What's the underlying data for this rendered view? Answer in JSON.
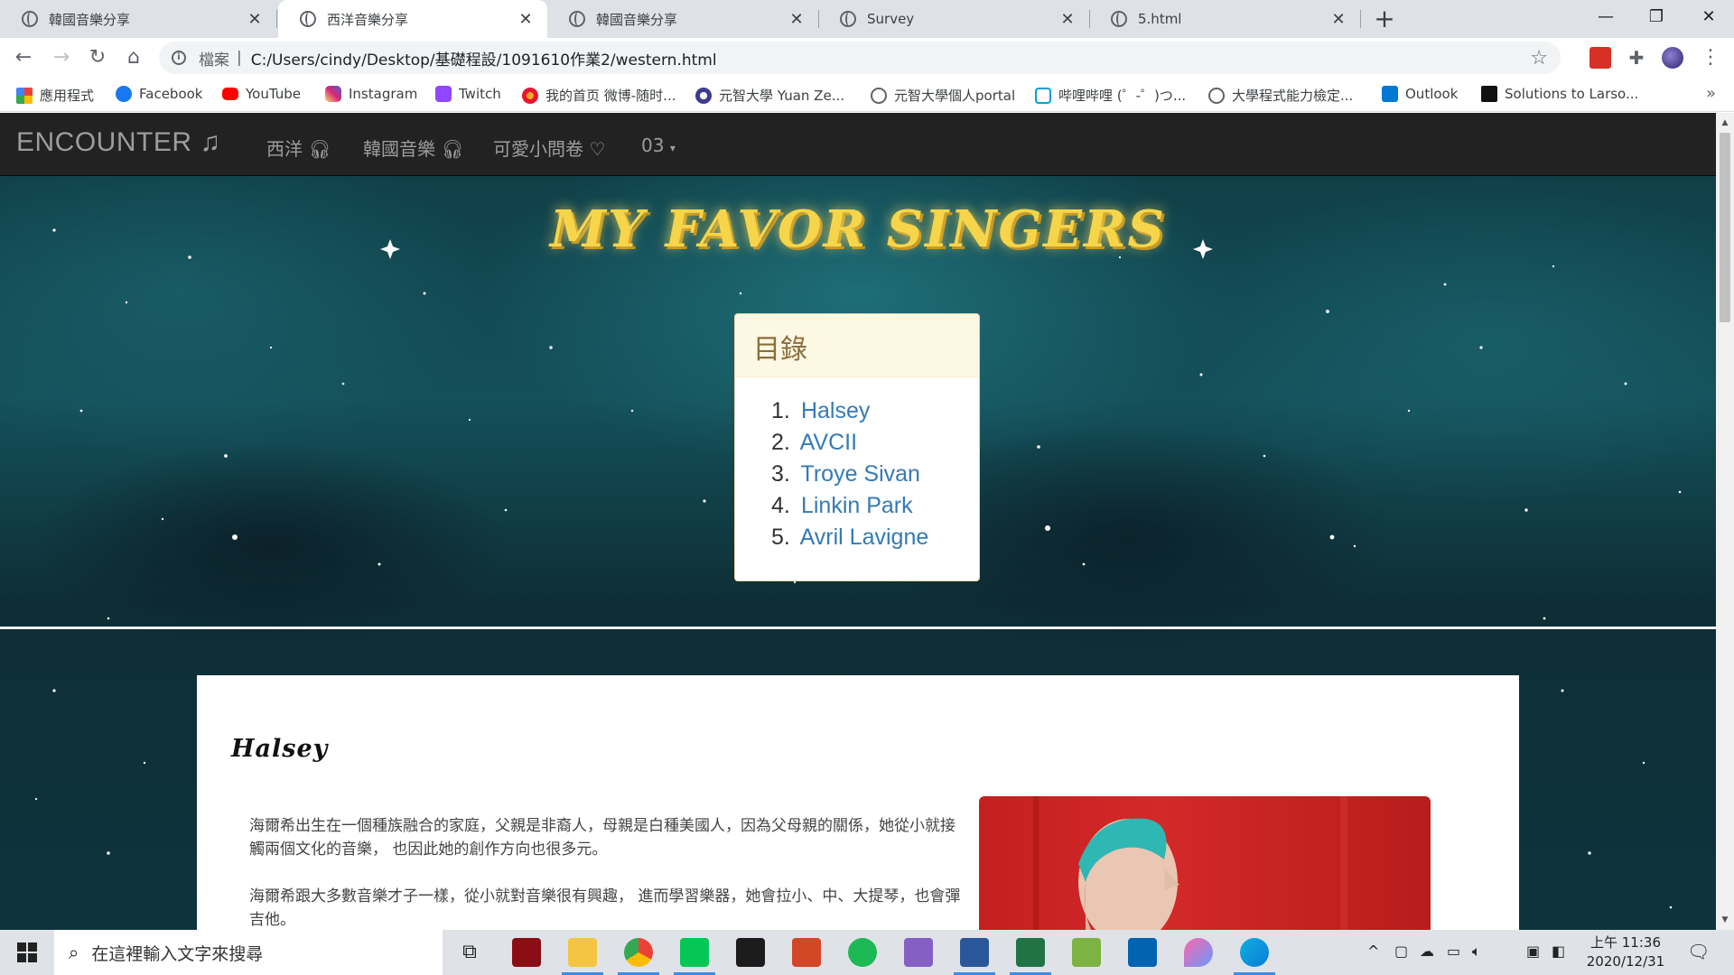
{
  "browser": {
    "tabs": [
      {
        "title": "韓國音樂分享",
        "active": false
      },
      {
        "title": "西洋音樂分享",
        "active": true
      },
      {
        "title": "韓國音樂分享",
        "active": false
      },
      {
        "title": "Survey",
        "active": false
      },
      {
        "title": "5.html",
        "active": false
      }
    ],
    "address": {
      "label": "檔案",
      "url": "C:/Users/cindy/Desktop/基礎程設/1091610作業2/western.html"
    },
    "bookmarks": [
      {
        "label": "應用程式",
        "icon": "apps-grid-icon"
      },
      {
        "label": "Facebook",
        "icon": "facebook-icon"
      },
      {
        "label": "YouTube",
        "icon": "youtube-icon"
      },
      {
        "label": "Instagram",
        "icon": "instagram-icon"
      },
      {
        "label": "Twitch",
        "icon": "twitch-icon"
      },
      {
        "label": "我的首页 微博-随时...",
        "icon": "weibo-icon"
      },
      {
        "label": "元智大學 Yuan Ze...",
        "icon": "university-seal-icon"
      },
      {
        "label": "元智大學個人portal",
        "icon": "globe-icon"
      },
      {
        "label": "哔哩哔哩 (゜-゜)つ...",
        "icon": "bilibili-icon"
      },
      {
        "label": "大學程式能力檢定...",
        "icon": "globe-icon"
      },
      {
        "label": "Outlook",
        "icon": "outlook-icon"
      },
      {
        "label": "Solutions to Larso...",
        "icon": "solutions-icon"
      }
    ],
    "bookmarks_more": "»",
    "window_controls": {
      "minimize": "—",
      "restore": "❐",
      "close": "✕"
    }
  },
  "site": {
    "brand": "ENCOUNTER",
    "brand_icon": "music-note-icon",
    "nav": [
      {
        "label": "西洋",
        "icon": "headphones-icon"
      },
      {
        "label": "韓國音樂",
        "icon": "headphones-icon"
      },
      {
        "label": "可愛小問卷",
        "icon": "heart-icon"
      },
      {
        "label": "03",
        "icon": "caret-down-icon"
      }
    ],
    "hero_title": "MY FAVOR SINGERS",
    "toc": {
      "heading": "目錄",
      "items": [
        {
          "num": "1.",
          "label": "Halsey"
        },
        {
          "num": "2.",
          "label": "AVCII"
        },
        {
          "num": "3.",
          "label": "Troye Sivan"
        },
        {
          "num": "4.",
          "label": "Linkin Park"
        },
        {
          "num": "5.",
          "label": "Avril Lavigne"
        }
      ]
    },
    "article": {
      "title": "Halsey",
      "paragraphs": [
        "海爾希出生在一個種族融合的家庭，父親是非裔人，母親是白種美國人，因為父母親的關係，她從小就接觸兩個文化的音樂， 也因此她的創作方向也很多元。",
        "海爾希跟大多數音樂才子一樣，從小就對音樂很有興趣， 進而學習樂器，她會拉小、中、大提琴，也會彈吉他。"
      ]
    }
  },
  "taskbar": {
    "search_placeholder": "在這裡輸入文字來搜尋",
    "clock_time": "上午 11:36",
    "clock_date": "2020/12/31"
  },
  "colors": {
    "navbar": "#222222",
    "hero_title": "#f7d54a",
    "toc_header_bg": "#fcf8e3",
    "toc_header_text": "#8a6d3b",
    "link": "#337ab7"
  }
}
